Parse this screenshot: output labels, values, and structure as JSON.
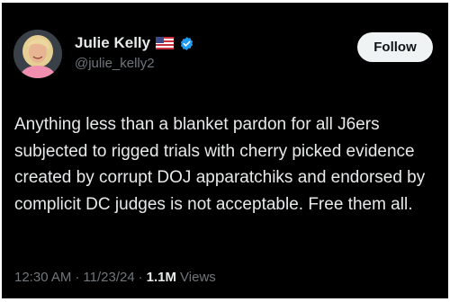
{
  "tweet": {
    "author": {
      "display_name": "Julie Kelly",
      "handle": "@julie_kelly2",
      "flag_icon": "us-flag-icon",
      "verified_icon": "verified-badge-icon"
    },
    "follow_label": "Follow",
    "text": "Anything less than a blanket pardon for all J6ers subjected to rigged trials with cherry picked evidence created by corrupt DOJ apparatchiks and endorsed by complicit DC judges is not acceptable. Free them all.",
    "time": "12:30 AM",
    "separator": "·",
    "date": "11/23/24",
    "views_count": "1.1M",
    "views_label": "Views"
  },
  "colors": {
    "background": "#000000",
    "primary_text": "#e7e9ea",
    "secondary_text": "#71767b",
    "follow_button_bg": "#eff3f4",
    "verified_blue": "#1d9bf0"
  }
}
